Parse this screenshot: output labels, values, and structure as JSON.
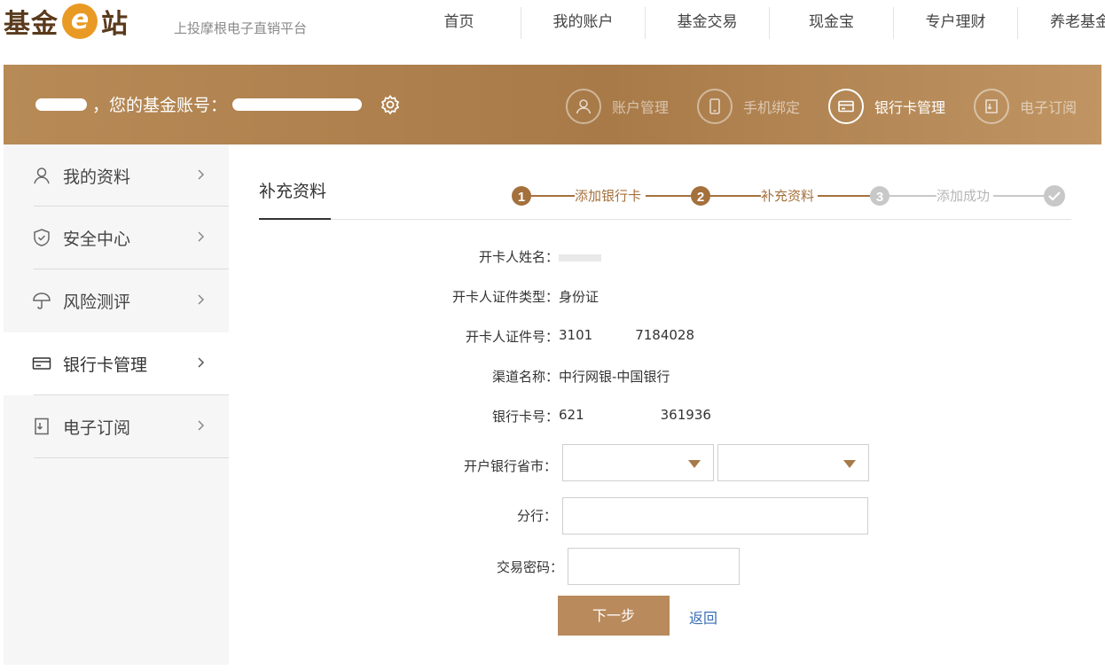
{
  "header": {
    "logo_left": "基金",
    "logo_e": "e",
    "logo_right": "站",
    "slogan": "上投摩根电子直销平台",
    "nav": [
      "首页",
      "我的账户",
      "基金交易",
      "现金宝",
      "专户理财",
      "养老基金"
    ]
  },
  "banner": {
    "greeting": "，您的基金账号：",
    "links": [
      {
        "label": "账户管理",
        "icon": "user-icon"
      },
      {
        "label": "手机绑定",
        "icon": "phone-icon"
      },
      {
        "label": "银行卡管理",
        "icon": "bank-card-icon"
      },
      {
        "label": "电子订阅",
        "icon": "subscribe-icon"
      }
    ],
    "active_link": "银行卡管理"
  },
  "sidebar": {
    "items": [
      {
        "label": "我的资料",
        "icon": "user-icon"
      },
      {
        "label": "安全中心",
        "icon": "shield-icon"
      },
      {
        "label": "风险测评",
        "icon": "umbrella-icon"
      },
      {
        "label": "银行卡管理",
        "icon": "bank-card-icon"
      },
      {
        "label": "电子订阅",
        "icon": "subscribe-icon"
      }
    ],
    "active_item": "银行卡管理"
  },
  "main": {
    "title": "补充资料",
    "steps": [
      {
        "num": "1",
        "label": "添加银行卡",
        "state": "done"
      },
      {
        "num": "2",
        "label": "补充资料",
        "state": "current"
      },
      {
        "num": "3",
        "label": "添加成功",
        "state": "pending"
      }
    ],
    "fields": [
      {
        "key": "开卡人姓名：",
        "value": ""
      },
      {
        "key": "开卡人证件类型：",
        "value": "身份证"
      },
      {
        "key": "开卡人证件号：",
        "value": "3101"
      },
      {
        "key": "渠道名称：",
        "value": "中行网银-中国银行"
      },
      {
        "key": "银行卡号：",
        "value": "621"
      }
    ],
    "id_suffix": "7184028",
    "card_suffix": "361936",
    "province_label": "开户银行省市：",
    "branch_label": "分行：",
    "password_label": "交易密码：",
    "next_button": "下一步",
    "back_link": "返回"
  },
  "colors": {
    "accent": "#b98a5c",
    "banner": "#a87a48",
    "link": "#3a6fb5",
    "step_pending": "#c8c8c8"
  }
}
